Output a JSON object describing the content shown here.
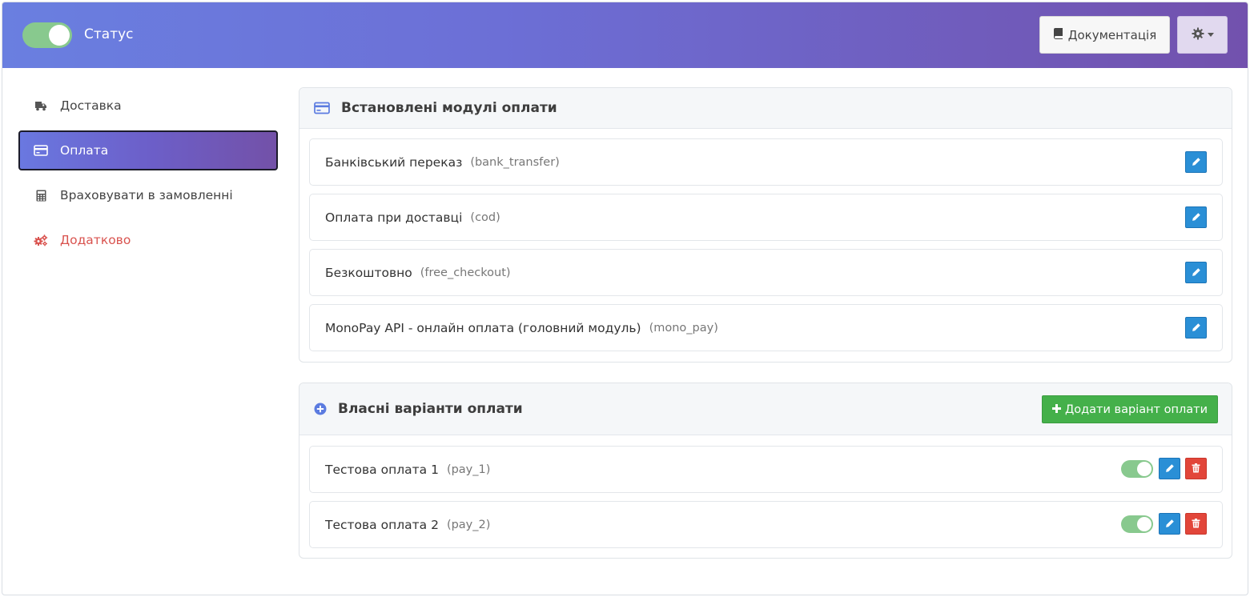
{
  "header": {
    "status_label": "Статус",
    "status_on": true,
    "doc_button": "Документація",
    "doc_icon": "book-icon",
    "settings_icon": "gear-icon"
  },
  "sidebar": {
    "items": [
      {
        "label": "Доставка",
        "icon": "truck-icon",
        "active": false
      },
      {
        "label": "Оплата",
        "icon": "credit-card-icon",
        "active": true
      },
      {
        "label": "Враховувати в замовленні",
        "icon": "calculator-icon",
        "active": false
      },
      {
        "label": "Додатково",
        "icon": "gears-icon",
        "active": false
      }
    ]
  },
  "installed": {
    "title": "Встановлені модулі оплати",
    "icon": "credit-card-icon",
    "items": [
      {
        "name": "Банківський переказ",
        "code": "(bank_transfer)"
      },
      {
        "name": "Оплата при доставці",
        "code": "(cod)"
      },
      {
        "name": "Безкоштовно",
        "code": "(free_checkout)"
      },
      {
        "name": "MonoPay API - онлайн оплата (головний модуль)",
        "code": "(mono_pay)"
      }
    ]
  },
  "custom": {
    "title": "Власні варіанти оплати",
    "icon": "plus-circle-icon",
    "add_button": "Додати варіант оплати",
    "items": [
      {
        "name": "Тестова оплата 1",
        "code": "(pay_1)",
        "enabled": true
      },
      {
        "name": "Тестова оплата 2",
        "code": "(pay_2)",
        "enabled": true
      }
    ]
  },
  "colors": {
    "header_start": "#6a7fe0",
    "header_end": "#7251ad",
    "toggle_on": "#88c98e",
    "edit_button": "#2a8fd6",
    "delete_button": "#e2463a",
    "add_button": "#44b04a",
    "extra_link": "#d9534f"
  }
}
